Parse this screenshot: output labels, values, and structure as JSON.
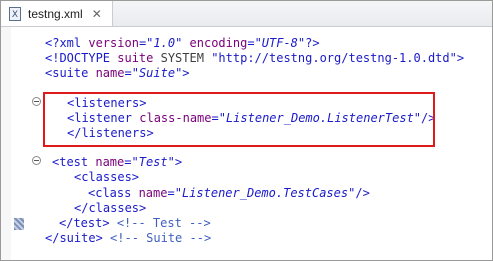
{
  "tab": {
    "icon_glyph": "X",
    "label": "testng.xml",
    "close_glyph": "✕"
  },
  "code": {
    "l1": {
      "open": "<?xml ",
      "a1": "version",
      "eq1": "=",
      "v1": "\"1.0\"",
      "sp": " ",
      "a2": "encoding",
      "eq2": "=",
      "v2": "\"UTF-8\"",
      "close": "?>"
    },
    "l2": {
      "open": "<!DOCTYPE ",
      "kw1": "suite",
      "sp1": " ",
      "kw2": "SYSTEM",
      "sp2": " ",
      "str": "\"http://testng.org/testng-1.0.dtd\"",
      "close": ">"
    },
    "l3": {
      "open": "<suite ",
      "a1": "name",
      "eq1": "=",
      "v1": "\"Suite\"",
      "close": ">"
    },
    "l4": {
      "text": "<listeners>"
    },
    "l5": {
      "open": "<listener ",
      "a1": "class-name",
      "eq1": "=",
      "v1": "\"Listener_Demo.ListenerTest\"",
      "close": "/>"
    },
    "l6": {
      "text": "</listeners>"
    },
    "l7": {
      "open": "<test ",
      "a1": "name",
      "eq1": "=",
      "v1": "\"Test\"",
      "close": ">"
    },
    "l8": {
      "text": "<classes>"
    },
    "l9": {
      "open": "<class ",
      "a1": "name",
      "eq1": "=",
      "v1": "\"Listener_Demo.TestCases\"",
      "close": "/>"
    },
    "l10": {
      "text": "</classes>"
    },
    "l11": {
      "tag": "</test>",
      "sp": " ",
      "comment": "<!-- Test -->"
    },
    "l12": {
      "tag": "</suite>",
      "sp": " ",
      "comment": "<!-- Suite -->"
    }
  },
  "colors": {
    "highlight_border": "#e01a1a",
    "tag": "#1a1ac9",
    "attribute": "#7a007a",
    "comment": "#3f5fbf"
  }
}
